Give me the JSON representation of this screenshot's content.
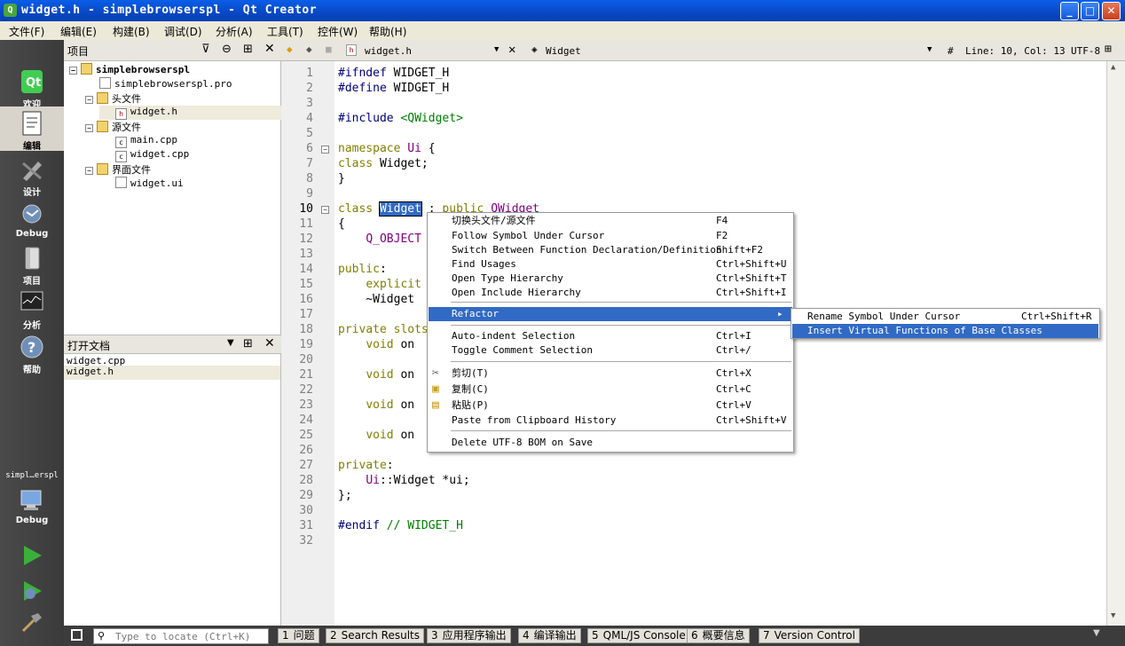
{
  "window": {
    "title": "widget.h - simplebrowserspl - Qt Creator",
    "min": "_",
    "max": "□",
    "close": "✕"
  },
  "menubar": [
    "文件(F)",
    "编辑(E)",
    "构建(B)",
    "调试(D)",
    "分析(A)",
    "工具(T)",
    "控件(W)",
    "帮助(H)"
  ],
  "modes": [
    {
      "label": "欢迎"
    },
    {
      "label": "编辑"
    },
    {
      "label": "设计"
    },
    {
      "label": "Debug"
    },
    {
      "label": "项目"
    },
    {
      "label": "分析"
    },
    {
      "label": "帮助"
    }
  ],
  "target": {
    "project": "simpl…erspl",
    "config": "Debug"
  },
  "project_panel": {
    "title": "项目",
    "tree": [
      {
        "label": "simplebrowserspl"
      },
      {
        "label": "simplebrowserspl.pro"
      },
      {
        "label": "头文件"
      },
      {
        "label": "widget.h"
      },
      {
        "label": "源文件"
      },
      {
        "label": "main.cpp"
      },
      {
        "label": "widget.cpp"
      },
      {
        "label": "界面文件"
      },
      {
        "label": "widget.ui"
      }
    ]
  },
  "open_docs": {
    "title": "打开文档",
    "items": [
      "widget.cpp",
      "widget.h"
    ]
  },
  "editor_toolbar": {
    "file": "widget.h",
    "symbol": "Widget",
    "hash": "#",
    "position": "Line: 10, Col: 13",
    "encoding": "UTF-8"
  },
  "code_lines": [
    "#ifndef WIDGET_H",
    "#define WIDGET_H",
    "",
    "#include <QWidget>",
    "",
    "namespace Ui {",
    "class Widget;",
    "}",
    "",
    "class Widget : public QWidget",
    "{",
    "    Q_OBJECT",
    "",
    "public:",
    "    explicit",
    "    ~Widget",
    "",
    "private slots:",
    "    void on",
    "",
    "    void on",
    "",
    "    void on",
    "",
    "    void on",
    "",
    "private:",
    "    Ui::Widget *ui;",
    "};",
    "",
    "#endif // WIDGET_H",
    ""
  ],
  "line_numbers": [
    "1",
    "2",
    "3",
    "4",
    "5",
    "6",
    "7",
    "8",
    "9",
    "10",
    "11",
    "12",
    "13",
    "14",
    "15",
    "16",
    "17",
    "18",
    "19",
    "20",
    "21",
    "22",
    "23",
    "24",
    "25",
    "26",
    "27",
    "28",
    "29",
    "30",
    "31",
    "32"
  ],
  "context_menu": [
    {
      "label": "切换头文件/源文件",
      "key": "F4"
    },
    {
      "label": "Follow Symbol Under Cursor",
      "key": "F2"
    },
    {
      "label": "Switch Between Function Declaration/Definition",
      "key": "Shift+F2"
    },
    {
      "label": "Find Usages",
      "key": "Ctrl+Shift+U"
    },
    {
      "label": "Open Type Hierarchy",
      "key": "Ctrl+Shift+T"
    },
    {
      "label": "Open Include Hierarchy",
      "key": "Ctrl+Shift+I"
    },
    {
      "label": "Refactor",
      "key": ""
    },
    {
      "label": "Auto-indent Selection",
      "key": "Ctrl+I"
    },
    {
      "label": "Toggle Comment Selection",
      "key": "Ctrl+/"
    },
    {
      "label": "剪切(T)",
      "key": "Ctrl+X"
    },
    {
      "label": "复制(C)",
      "key": "Ctrl+C"
    },
    {
      "label": "粘贴(P)",
      "key": "Ctrl+V"
    },
    {
      "label": "Paste from Clipboard History",
      "key": "Ctrl+Shift+V"
    },
    {
      "label": "Delete UTF-8 BOM on Save",
      "key": ""
    }
  ],
  "submenu": [
    {
      "label": "Rename Symbol Under Cursor",
      "key": "Ctrl+Shift+R"
    },
    {
      "label": "Insert Virtual Functions of Base Classes",
      "key": ""
    }
  ],
  "statusbar": {
    "locate_placeholder": "Type to locate (Ctrl+K)",
    "tabs": [
      {
        "num": "1",
        "label": "问题"
      },
      {
        "num": "2",
        "label": "Search Results"
      },
      {
        "num": "3",
        "label": "应用程序输出"
      },
      {
        "num": "4",
        "label": "编译输出"
      },
      {
        "num": "5",
        "label": "QML/JS Console"
      },
      {
        "num": "6",
        "label": "概要信息"
      },
      {
        "num": "7",
        "label": "Version Control"
      }
    ]
  }
}
